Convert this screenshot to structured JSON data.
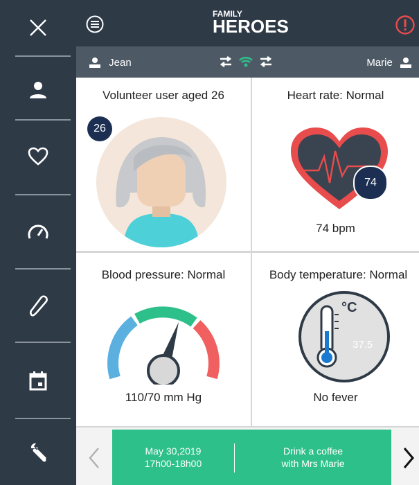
{
  "app": {
    "logo_line1": "FAMILY",
    "logo_line2": "HEROES"
  },
  "sidebar": {
    "items": [
      {
        "icon": "close-icon"
      },
      {
        "icon": "user-icon"
      },
      {
        "icon": "heart-icon"
      },
      {
        "icon": "speedometer-icon"
      },
      {
        "icon": "thermometer-icon"
      },
      {
        "icon": "calendar-icon"
      },
      {
        "icon": "wrench-icon"
      }
    ]
  },
  "header": {
    "menu_icon": "menu-icon",
    "alert_icon": "alert-icon"
  },
  "userbar": {
    "left_user": "Jean",
    "right_user": "Marie",
    "connection_icon": "wifi-icon"
  },
  "cards": {
    "user": {
      "title": "Volunteer user aged 26",
      "age": "26"
    },
    "heart": {
      "title": "Heart rate: Normal",
      "badge": "74",
      "value": "74 bpm"
    },
    "pressure": {
      "title": "Blood pressure: Normal",
      "value": "110/70 mm Hg"
    },
    "temperature": {
      "title": "Body temperature: Normal",
      "unit": "°C",
      "reading": "37.5",
      "value": "No fever"
    }
  },
  "event": {
    "date": "May 30,2019",
    "time": "17h00-18h00",
    "line1": "Drink a coffee",
    "line2": "with Mrs Marie"
  },
  "colors": {
    "dark": "#2f3a47",
    "bar": "#4d5a66",
    "accent": "#2ec08a",
    "alert": "#e84c4c",
    "heart": "#e84c4c",
    "badge": "#1c2f52"
  }
}
